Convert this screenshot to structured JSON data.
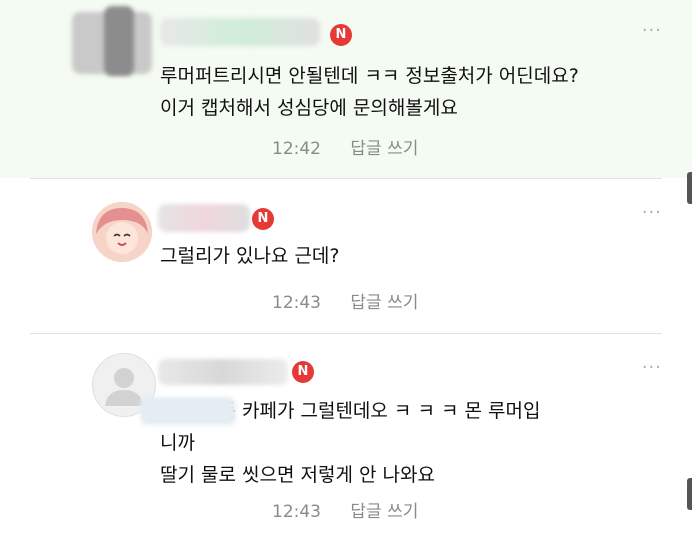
{
  "comments": [
    {
      "badge": "N",
      "lines": [
        "루머퍼트리시면 안될텐데 ㅋㅋ 정보출처가 어딘데요?",
        "이거 캡처해서 성심당에 문의해볼게요"
      ],
      "time": "12:42",
      "reply_label": "답글 쓰기",
      "more": "···"
    },
    {
      "badge": "N",
      "lines": [
        "그럴리가 있나요 근데?"
      ],
      "time": "12:43",
      "reply_label": "답글 쓰기",
      "more": "···"
    },
    {
      "badge": "N",
      "lines": [
        "어의 모든 카페가 그럴텐데오 ㅋ ㅋ ㅋ 몬 루머입",
        "니까",
        "딸기 물로 씻으면 저렇게 안 나와요"
      ],
      "time": "12:43",
      "reply_label": "답글 쓰기",
      "more": "···"
    }
  ],
  "colors": {
    "highlight_bg": "#f4fbf2",
    "badge": "#e53935",
    "meta_text": "#8a8a8a"
  }
}
